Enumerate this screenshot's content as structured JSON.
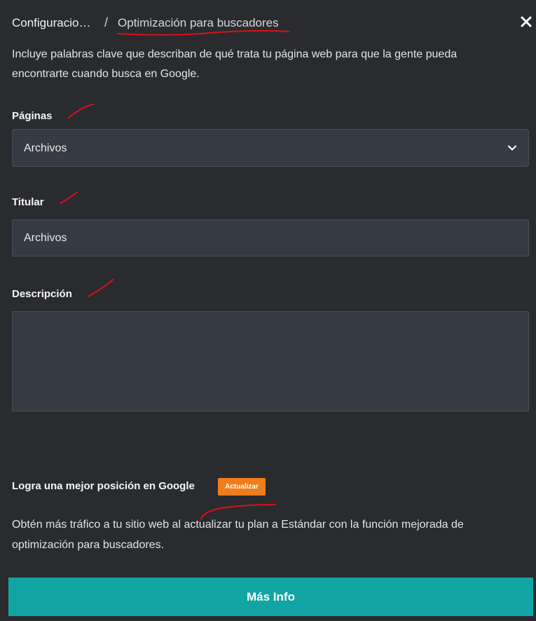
{
  "header": {
    "breadcrumb_parent": "Configuracio…",
    "separator": "/",
    "breadcrumb_current": "Optimización para buscadores",
    "close_icon": "close-icon"
  },
  "intro": {
    "text": "Incluye palabras clave que describan de qué trata tu página web para que la gente pueda encontrarte cuando busca en Google."
  },
  "fields": {
    "pages": {
      "label": "Páginas",
      "value": "Archivos",
      "icon": "chevron-down-icon"
    },
    "title": {
      "label": "Titular",
      "value": "Archivos"
    },
    "description": {
      "label": "Descripción",
      "value": ""
    }
  },
  "promo": {
    "title": "Logra una mejor posición en Google",
    "badge": "Actualizar",
    "text": "Obtén más tráfico a tu sitio web al actualizar tu plan a Estándar con la función mejorada de optimización para buscadores."
  },
  "cta": {
    "label": "Más Info"
  },
  "colors": {
    "background": "#2a2b2f",
    "field_bg": "#363a42",
    "badge": "#f07d1b",
    "cta": "#10a5a2",
    "annotation": "#d8111b"
  }
}
